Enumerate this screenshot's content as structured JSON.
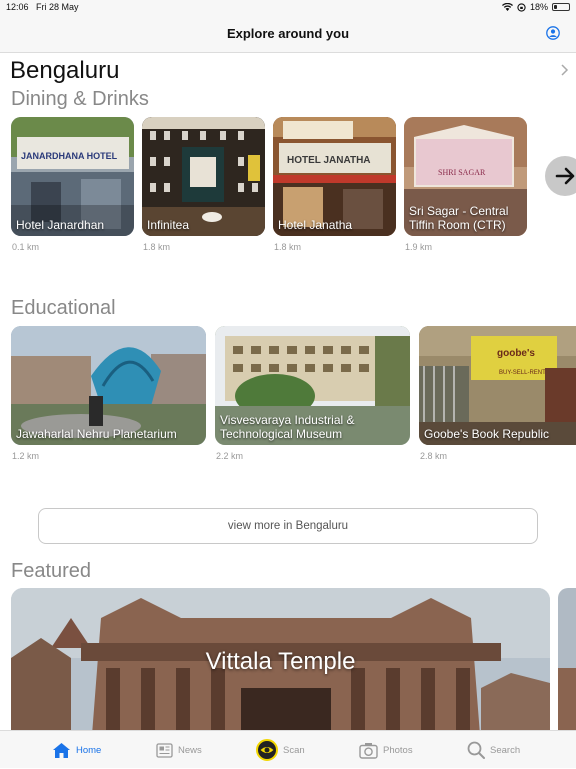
{
  "status_bar": {
    "time": "12:06",
    "date": "Fri 28 May",
    "battery": "18%",
    "battery_level": 0.18
  },
  "navbar": {
    "title": "Explore around you"
  },
  "city": {
    "name": "Bengaluru"
  },
  "sections": {
    "dining": {
      "title": "Dining & Drinks",
      "items": [
        {
          "name": "Hotel Janardhan",
          "distance": "0.1 km"
        },
        {
          "name": "Infinitea",
          "distance": "1.8 km"
        },
        {
          "name": "Hotel Janatha",
          "distance": "1.8 km"
        },
        {
          "name": "Sri Sagar - Central Tiffin Room (CTR)",
          "distance": "1.9 km"
        }
      ]
    },
    "educational": {
      "title": "Educational",
      "items": [
        {
          "name": "Jawaharlal Nehru Planetarium",
          "distance": "1.2 km"
        },
        {
          "name": "Visvesvaraya Industrial & Technological Museum",
          "distance": "2.2 km"
        },
        {
          "name": "Goobe's Book Republic",
          "distance": "2.8 km"
        }
      ]
    },
    "view_more": "view more in Bengaluru",
    "featured": {
      "title": "Featured",
      "item": {
        "name": "Vittala Temple"
      }
    }
  },
  "card_signs": {
    "janardhan_sign": "JANARDHANA HOTEL",
    "janatha_sign": "HOTEL JANATHA",
    "srisagar_sign": "SHRI SAGAR",
    "goobes_sign": "goobe's",
    "goobes_sub": "BUY-SELL-RENT"
  },
  "tabs": [
    {
      "label": "Home",
      "icon": "house-icon"
    },
    {
      "label": "News",
      "icon": "newspaper-icon"
    },
    {
      "label": "Scan",
      "icon": "eye-icon"
    },
    {
      "label": "Photos",
      "icon": "camera-icon"
    },
    {
      "label": "Search",
      "icon": "magnifier-icon"
    }
  ],
  "colors": {
    "accent": "#1a73e8",
    "scan_ring": "#f2d600"
  }
}
